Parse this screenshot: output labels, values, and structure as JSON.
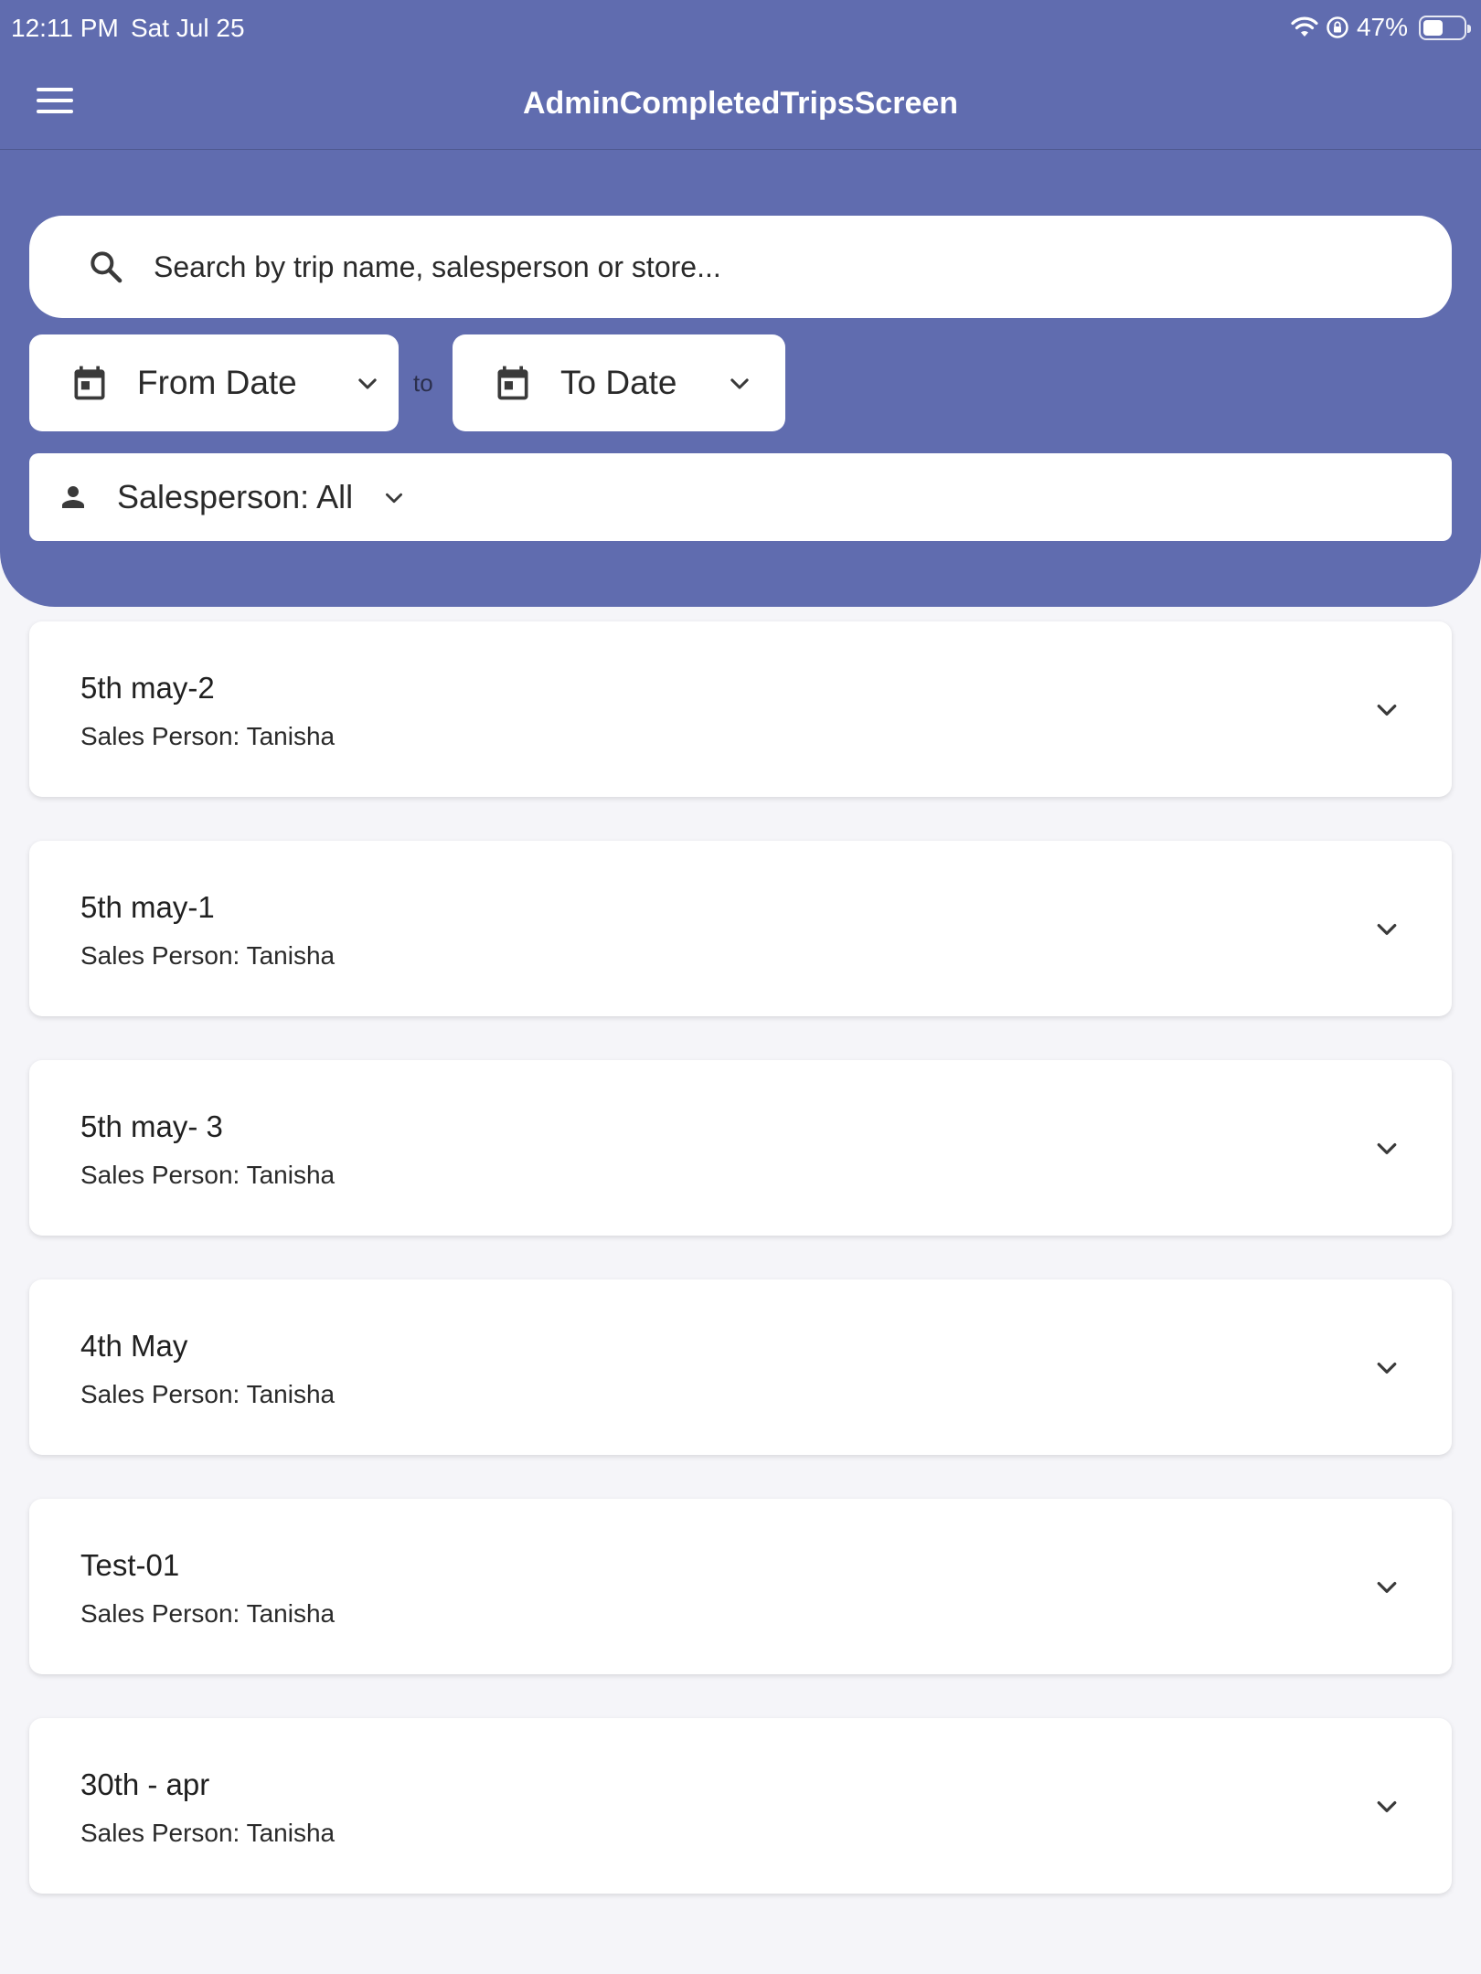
{
  "status_bar": {
    "time": "12:11 PM",
    "date": "Sat Jul 25",
    "battery": "47%",
    "battery_level": 0.47
  },
  "app_bar": {
    "title": "AdminCompletedTripsScreen",
    "menu_icon": "hamburger-menu-icon"
  },
  "filters": {
    "search_placeholder": "Search by trip name, salesperson or store...",
    "search_value": "",
    "from_date": "From Date",
    "separator": "to",
    "to_date": "To Date",
    "salesperson": "Salesperson: All"
  },
  "trips": [
    {
      "name": "5th may-2",
      "salesperson": "Sales Person: Tanisha"
    },
    {
      "name": "5th may-1",
      "salesperson": "Sales Person: Tanisha"
    },
    {
      "name": "5th may- 3",
      "salesperson": "Sales Person: Tanisha"
    },
    {
      "name": "4th May",
      "salesperson": "Sales Person: Tanisha"
    },
    {
      "name": "Test-01",
      "salesperson": "Sales Person: Tanisha"
    },
    {
      "name": "30th - apr",
      "salesperson": "Sales Person: Tanisha"
    }
  ],
  "colors": {
    "primary": "#606caf",
    "background": "#f5f5f9",
    "card": "#ffffff",
    "icon": "#3a3a3a"
  }
}
